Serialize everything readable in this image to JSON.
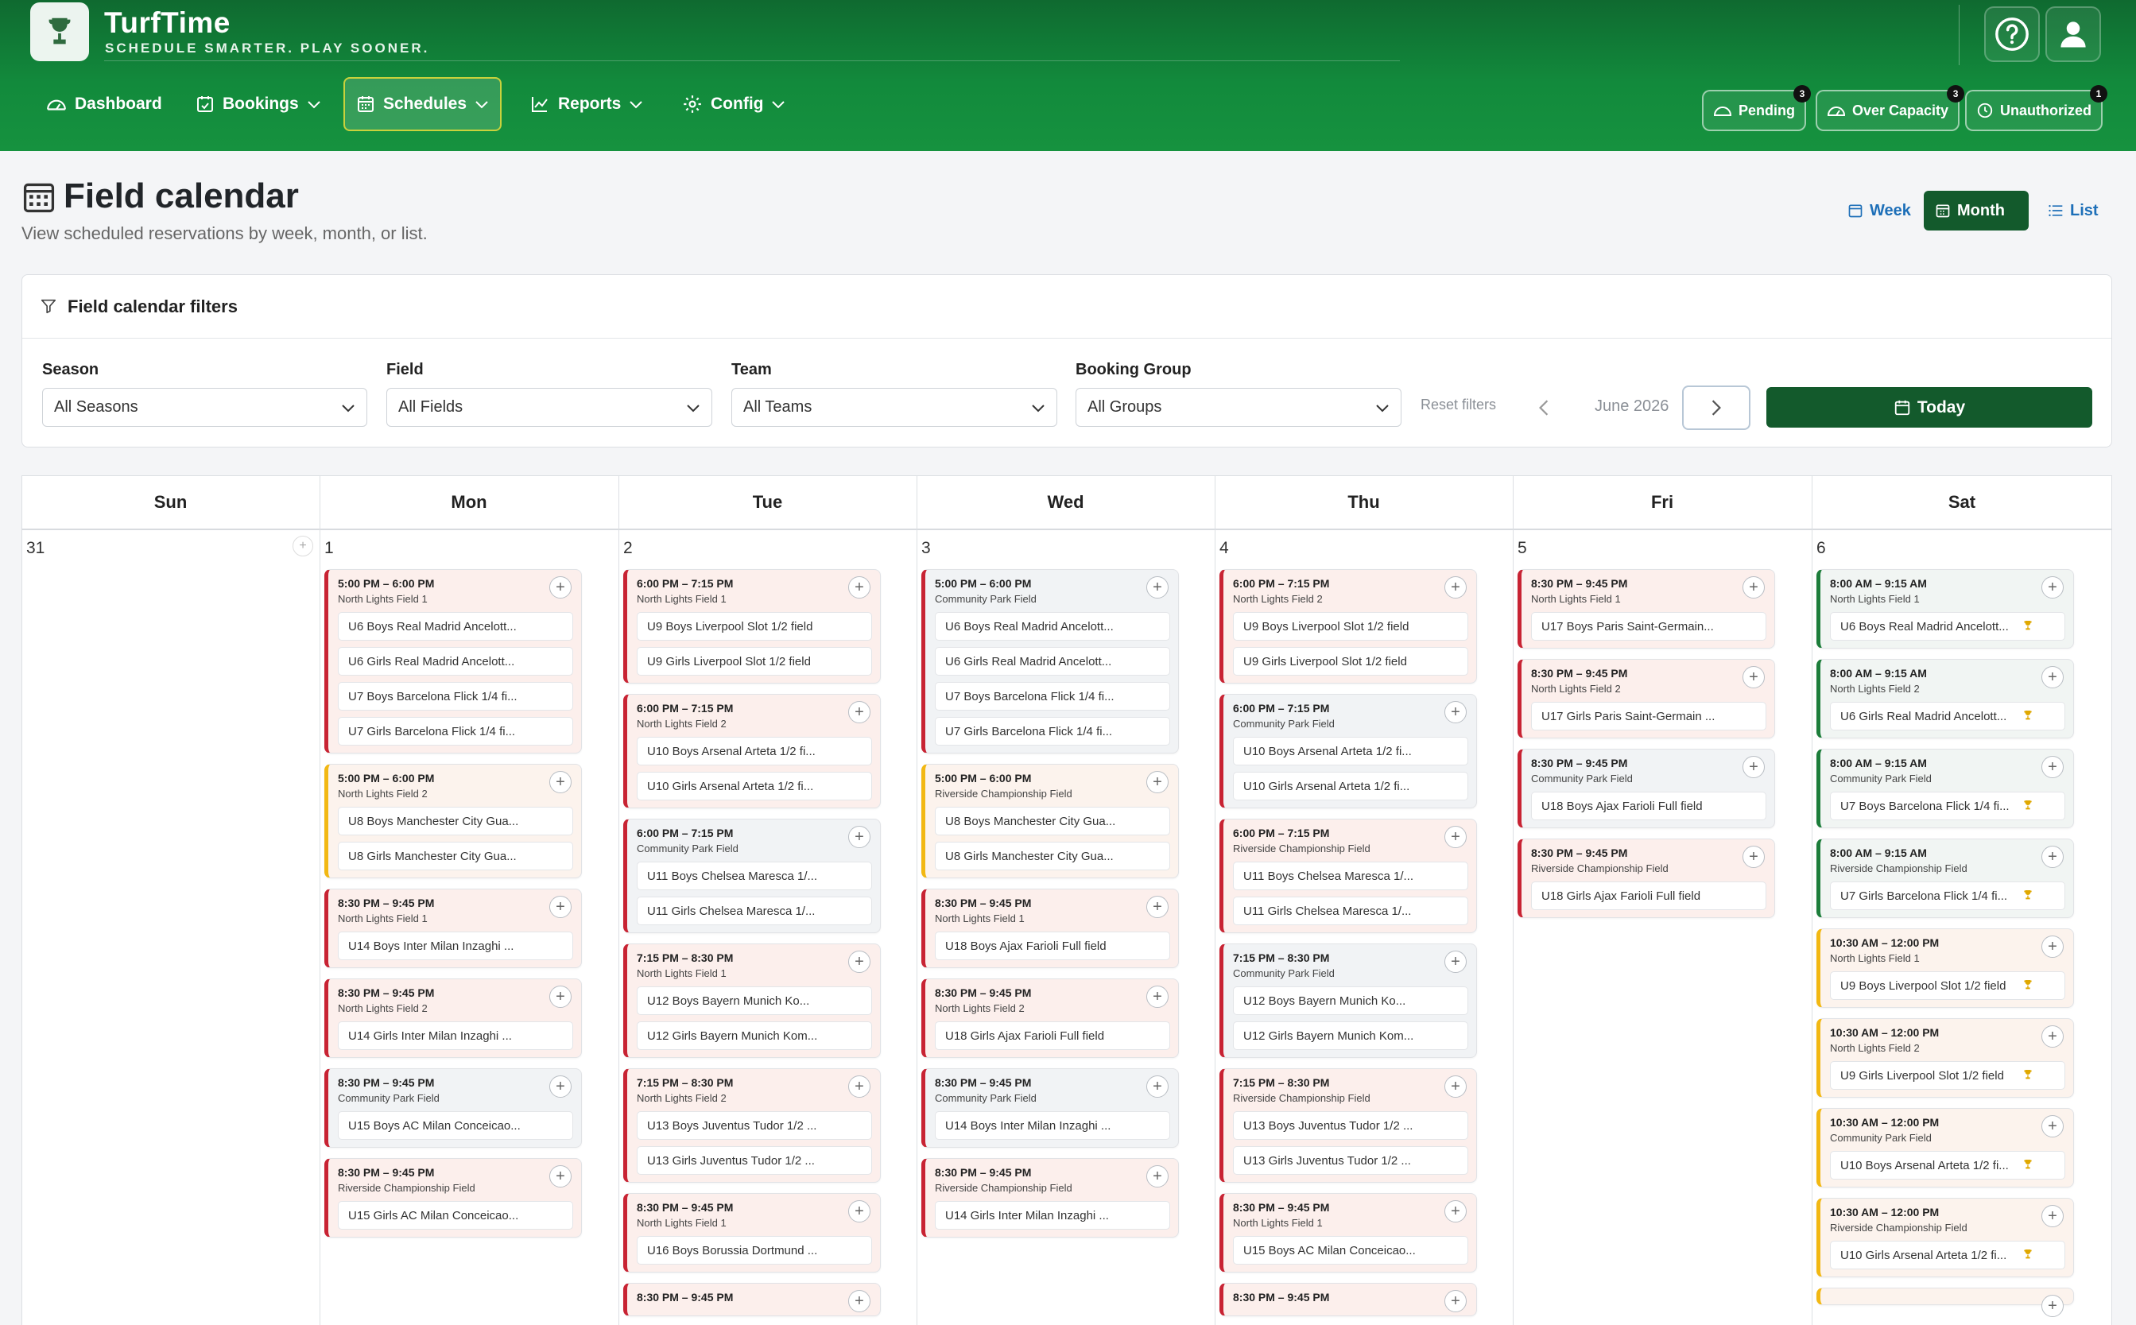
{
  "app": {
    "name": "TurfTime",
    "tagline": "SCHEDULE SMARTER. PLAY SOONER."
  },
  "nav": {
    "items": [
      {
        "label": "Dashboard",
        "icon": "dashboard-gauge-icon"
      },
      {
        "label": "Bookings",
        "icon": "calendar-check-icon",
        "dropdown": true
      },
      {
        "label": "Schedules",
        "icon": "calendar-grid-icon",
        "dropdown": true,
        "active": true
      },
      {
        "label": "Reports",
        "icon": "line-chart-icon",
        "dropdown": true
      },
      {
        "label": "Config",
        "icon": "gear-icon",
        "dropdown": true
      }
    ]
  },
  "status": {
    "pending": {
      "label": "Pending",
      "count": "3"
    },
    "over_capacity": {
      "label": "Over Capacity",
      "count": "3"
    },
    "unauthorized": {
      "label": "Unauthorized",
      "count": "1"
    }
  },
  "page": {
    "title": "Field calendar",
    "subtitle": "View scheduled reservations by week, month, or list."
  },
  "views": {
    "week": "Week",
    "month": "Month",
    "list": "List",
    "active": "Month"
  },
  "filters": {
    "title": "Field calendar filters",
    "season": {
      "label": "Season",
      "value": "All Seasons"
    },
    "field": {
      "label": "Field",
      "value": "All Fields"
    },
    "team": {
      "label": "Team",
      "value": "All Teams"
    },
    "group": {
      "label": "Booking Group",
      "value": "All Groups"
    },
    "reset": "Reset filters",
    "month": "June 2026",
    "today": "Today"
  },
  "calendar": {
    "days": [
      "Sun",
      "Mon",
      "Tue",
      "Wed",
      "Thu",
      "Fri",
      "Sat"
    ],
    "dates": [
      "31",
      "1",
      "2",
      "3",
      "4",
      "5",
      "6"
    ],
    "colors": {
      "red": "#c82333",
      "amber": "#f2b813",
      "green": "#1c7d3a"
    },
    "events": {
      "mon": [
        {
          "time": "5:00 PM – 6:00 PM",
          "field": "North Lights Field 1",
          "color": "red",
          "teams": [
            "U6 Boys Real Madrid Ancelott...",
            "U6 Girls Real Madrid Ancelott...",
            "U7 Boys Barcelona Flick 1/4 fi...",
            "U7 Girls Barcelona Flick 1/4 fi..."
          ]
        },
        {
          "time": "5:00 PM – 6:00 PM",
          "field": "North Lights Field 2",
          "color": "amber",
          "teams": [
            "U8 Boys Manchester City Gua...",
            "U8 Girls Manchester City Gua..."
          ]
        },
        {
          "time": "8:30 PM – 9:45 PM",
          "field": "North Lights Field 1",
          "color": "red",
          "teams": [
            "U14 Boys Inter Milan Inzaghi ..."
          ]
        },
        {
          "time": "8:30 PM – 9:45 PM",
          "field": "North Lights Field 2",
          "color": "red",
          "teams": [
            "U14 Girls Inter Milan Inzaghi ..."
          ]
        },
        {
          "time": "8:30 PM – 9:45 PM",
          "field": "Community Park Field",
          "color": "red",
          "teams": [
            "U15 Boys AC Milan Conceicao..."
          ]
        },
        {
          "time": "8:30 PM – 9:45 PM",
          "field": "Riverside Championship Field",
          "color": "red",
          "teams": [
            "U15 Girls AC Milan Conceicao..."
          ]
        }
      ],
      "tue": [
        {
          "time": "6:00 PM – 7:15 PM",
          "field": "North Lights Field 1",
          "color": "red",
          "teams": [
            "U9 Boys Liverpool Slot 1/2 field",
            "U9 Girls Liverpool Slot 1/2 field"
          ]
        },
        {
          "time": "6:00 PM – 7:15 PM",
          "field": "North Lights Field 2",
          "color": "red",
          "teams": [
            "U10 Boys Arsenal Arteta 1/2 fi...",
            "U10 Girls Arsenal Arteta 1/2 fi..."
          ]
        },
        {
          "time": "6:00 PM – 7:15 PM",
          "field": "Community Park Field",
          "color": "red",
          "teams": [
            "U11 Boys Chelsea Maresca 1/...",
            "U11 Girls Chelsea Maresca 1/..."
          ]
        },
        {
          "time": "7:15 PM – 8:30 PM",
          "field": "North Lights Field 1",
          "color": "red",
          "teams": [
            "U12 Boys Bayern Munich Ko...",
            "U12 Girls Bayern Munich Kom..."
          ]
        },
        {
          "time": "7:15 PM – 8:30 PM",
          "field": "North Lights Field 2",
          "color": "red",
          "teams": [
            "U13 Boys Juventus Tudor 1/2 ...",
            "U13 Girls Juventus Tudor 1/2 ..."
          ]
        },
        {
          "time": "8:30 PM – 9:45 PM",
          "field": "North Lights Field 1",
          "color": "red",
          "teams": [
            "U16 Boys Borussia Dortmund ..."
          ]
        },
        {
          "time": "8:30 PM – 9:45 PM",
          "field": "",
          "color": "red",
          "teams": []
        }
      ],
      "wed": [
        {
          "time": "5:00 PM – 6:00 PM",
          "field": "Community Park Field",
          "color": "red",
          "teams": [
            "U6 Boys Real Madrid Ancelott...",
            "U6 Girls Real Madrid Ancelott...",
            "U7 Boys Barcelona Flick 1/4 fi...",
            "U7 Girls Barcelona Flick 1/4 fi..."
          ]
        },
        {
          "time": "5:00 PM – 6:00 PM",
          "field": "Riverside Championship Field",
          "color": "amber",
          "teams": [
            "U8 Boys Manchester City Gua...",
            "U8 Girls Manchester City Gua..."
          ]
        },
        {
          "time": "8:30 PM – 9:45 PM",
          "field": "North Lights Field 1",
          "color": "red",
          "teams": [
            "U18 Boys Ajax Farioli Full field"
          ]
        },
        {
          "time": "8:30 PM – 9:45 PM",
          "field": "North Lights Field 2",
          "color": "red",
          "teams": [
            "U18 Girls Ajax Farioli Full field"
          ]
        },
        {
          "time": "8:30 PM – 9:45 PM",
          "field": "Community Park Field",
          "color": "red",
          "teams": [
            "U14 Boys Inter Milan Inzaghi ..."
          ]
        },
        {
          "time": "8:30 PM – 9:45 PM",
          "field": "Riverside Championship Field",
          "color": "red",
          "teams": [
            "U14 Girls Inter Milan Inzaghi ..."
          ]
        }
      ],
      "thu": [
        {
          "time": "6:00 PM – 7:15 PM",
          "field": "North Lights Field 2",
          "color": "red",
          "teams": [
            "U9 Boys Liverpool Slot 1/2 field",
            "U9 Girls Liverpool Slot 1/2 field"
          ]
        },
        {
          "time": "6:00 PM – 7:15 PM",
          "field": "Community Park Field",
          "color": "red",
          "teams": [
            "U10 Boys Arsenal Arteta 1/2 fi...",
            "U10 Girls Arsenal Arteta 1/2 fi..."
          ]
        },
        {
          "time": "6:00 PM – 7:15 PM",
          "field": "Riverside Championship Field",
          "color": "red",
          "teams": [
            "U11 Boys Chelsea Maresca 1/...",
            "U11 Girls Chelsea Maresca 1/..."
          ]
        },
        {
          "time": "7:15 PM – 8:30 PM",
          "field": "Community Park Field",
          "color": "red",
          "teams": [
            "U12 Boys Bayern Munich Ko...",
            "U12 Girls Bayern Munich Kom..."
          ]
        },
        {
          "time": "7:15 PM – 8:30 PM",
          "field": "Riverside Championship Field",
          "color": "red",
          "teams": [
            "U13 Boys Juventus Tudor 1/2 ...",
            "U13 Girls Juventus Tudor 1/2 ..."
          ]
        },
        {
          "time": "8:30 PM – 9:45 PM",
          "field": "North Lights Field 1",
          "color": "red",
          "teams": [
            "U15 Boys AC Milan Conceicao..."
          ]
        },
        {
          "time": "8:30 PM – 9:45 PM",
          "field": "",
          "color": "red",
          "teams": []
        }
      ],
      "fri": [
        {
          "time": "8:30 PM – 9:45 PM",
          "field": "North Lights Field 1",
          "color": "red",
          "teams": [
            "U17 Boys Paris Saint-Germain..."
          ]
        },
        {
          "time": "8:30 PM – 9:45 PM",
          "field": "North Lights Field 2",
          "color": "red",
          "teams": [
            "U17 Girls Paris Saint-Germain ..."
          ]
        },
        {
          "time": "8:30 PM – 9:45 PM",
          "field": "Community Park Field",
          "color": "red",
          "teams": [
            "U18 Boys Ajax Farioli Full field"
          ]
        },
        {
          "time": "8:30 PM – 9:45 PM",
          "field": "Riverside Championship Field",
          "color": "red",
          "teams": [
            "U18 Girls Ajax Farioli Full field"
          ]
        }
      ],
      "sat": [
        {
          "time": "8:00 AM – 9:15 AM",
          "field": "North Lights Field 1",
          "color": "green",
          "teams": [
            "U6 Boys Real Madrid Ancelott..."
          ],
          "trophy": true
        },
        {
          "time": "8:00 AM – 9:15 AM",
          "field": "North Lights Field 2",
          "color": "green",
          "teams": [
            "U6 Girls Real Madrid Ancelott..."
          ],
          "trophy": true
        },
        {
          "time": "8:00 AM – 9:15 AM",
          "field": "Community Park Field",
          "color": "green",
          "teams": [
            "U7 Boys Barcelona Flick 1/4 fi..."
          ],
          "trophy": true
        },
        {
          "time": "8:00 AM – 9:15 AM",
          "field": "Riverside Championship Field",
          "color": "green",
          "teams": [
            "U7 Girls Barcelona Flick 1/4 fi..."
          ],
          "trophy": true
        },
        {
          "time": "10:30 AM – 12:00 PM",
          "field": "North Lights Field 1",
          "color": "amber",
          "teams": [
            "U9 Boys Liverpool Slot 1/2 field"
          ],
          "trophy": true
        },
        {
          "time": "10:30 AM – 12:00 PM",
          "field": "North Lights Field 2",
          "color": "amber",
          "teams": [
            "U9 Girls Liverpool Slot 1/2 field"
          ],
          "trophy": true
        },
        {
          "time": "10:30 AM – 12:00 PM",
          "field": "Community Park Field",
          "color": "amber",
          "teams": [
            "U10 Boys Arsenal Arteta 1/2 fi..."
          ],
          "trophy": true
        },
        {
          "time": "10:30 AM – 12:00 PM",
          "field": "Riverside Championship Field",
          "color": "amber",
          "teams": [
            "U10 Girls Arsenal Arteta 1/2 fi..."
          ],
          "trophy": true
        },
        {
          "time": "",
          "field": "",
          "color": "amber",
          "teams": []
        }
      ]
    }
  }
}
